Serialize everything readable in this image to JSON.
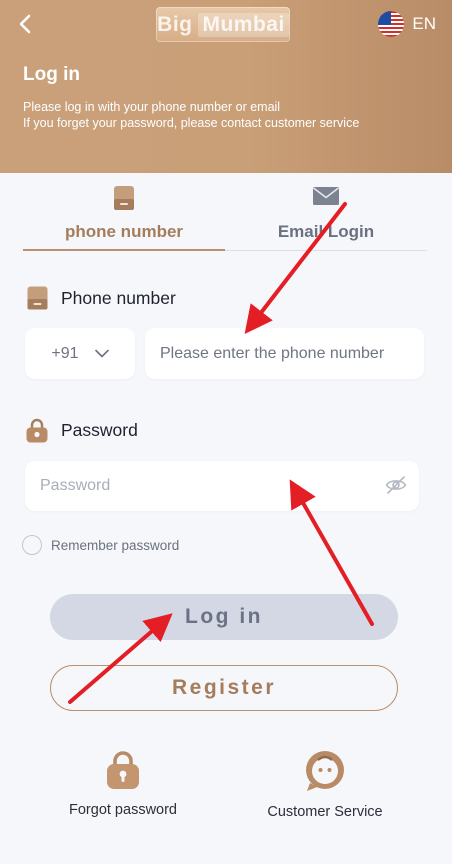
{
  "header": {
    "logo_part1": "Big",
    "logo_part2": "Mumbai",
    "language": "EN",
    "title": "Log in",
    "subtitle_line1": "Please log in with your phone number or email",
    "subtitle_line2": "If you forget your password, please contact customer service"
  },
  "tabs": [
    {
      "label": "phone number",
      "active": true,
      "icon": "phone-icon"
    },
    {
      "label": "Email Login",
      "active": false,
      "icon": "mail-icon"
    }
  ],
  "form": {
    "phone_label": "Phone number",
    "country_code": "+91",
    "phone_placeholder": "Please enter the phone number",
    "password_label": "Password",
    "password_placeholder": "Password",
    "remember_label": "Remember password"
  },
  "buttons": {
    "login": "Log in",
    "register": "Register"
  },
  "bottom": {
    "forgot": "Forgot password",
    "service": "Customer Service"
  },
  "colors": {
    "header_bg": "#c9a07a",
    "accent": "#a57d5c",
    "login_bg": "#d4d8e4",
    "arrow": "#e31e24"
  }
}
